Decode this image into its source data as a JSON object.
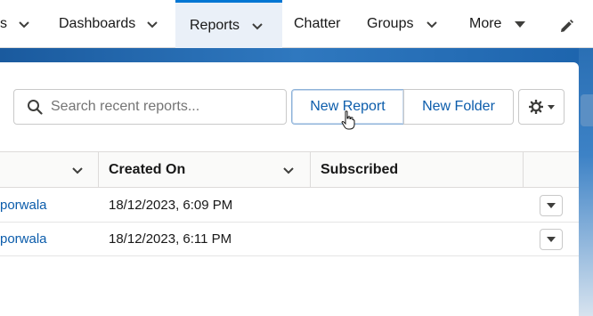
{
  "nav": {
    "items": [
      {
        "label": "s"
      },
      {
        "label": "Dashboards"
      },
      {
        "label": "Reports"
      },
      {
        "label": "Chatter"
      },
      {
        "label": "Groups"
      },
      {
        "label": "More"
      }
    ]
  },
  "toolbar": {
    "search_placeholder": "Search recent reports...",
    "new_report_label": "New Report",
    "new_folder_label": "New Folder"
  },
  "table": {
    "columns": [
      {
        "label": ""
      },
      {
        "label": "Created On"
      },
      {
        "label": "Subscribed"
      }
    ],
    "rows": [
      {
        "created_by": "porwala",
        "created_on": "18/12/2023, 6:09 PM",
        "subscribed": ""
      },
      {
        "created_by": "porwala",
        "created_on": "18/12/2023, 6:11 PM",
        "subscribed": ""
      }
    ]
  },
  "colors": {
    "accent": "#0176d3",
    "link": "#0b5cab",
    "banner": "#2f78bf"
  }
}
